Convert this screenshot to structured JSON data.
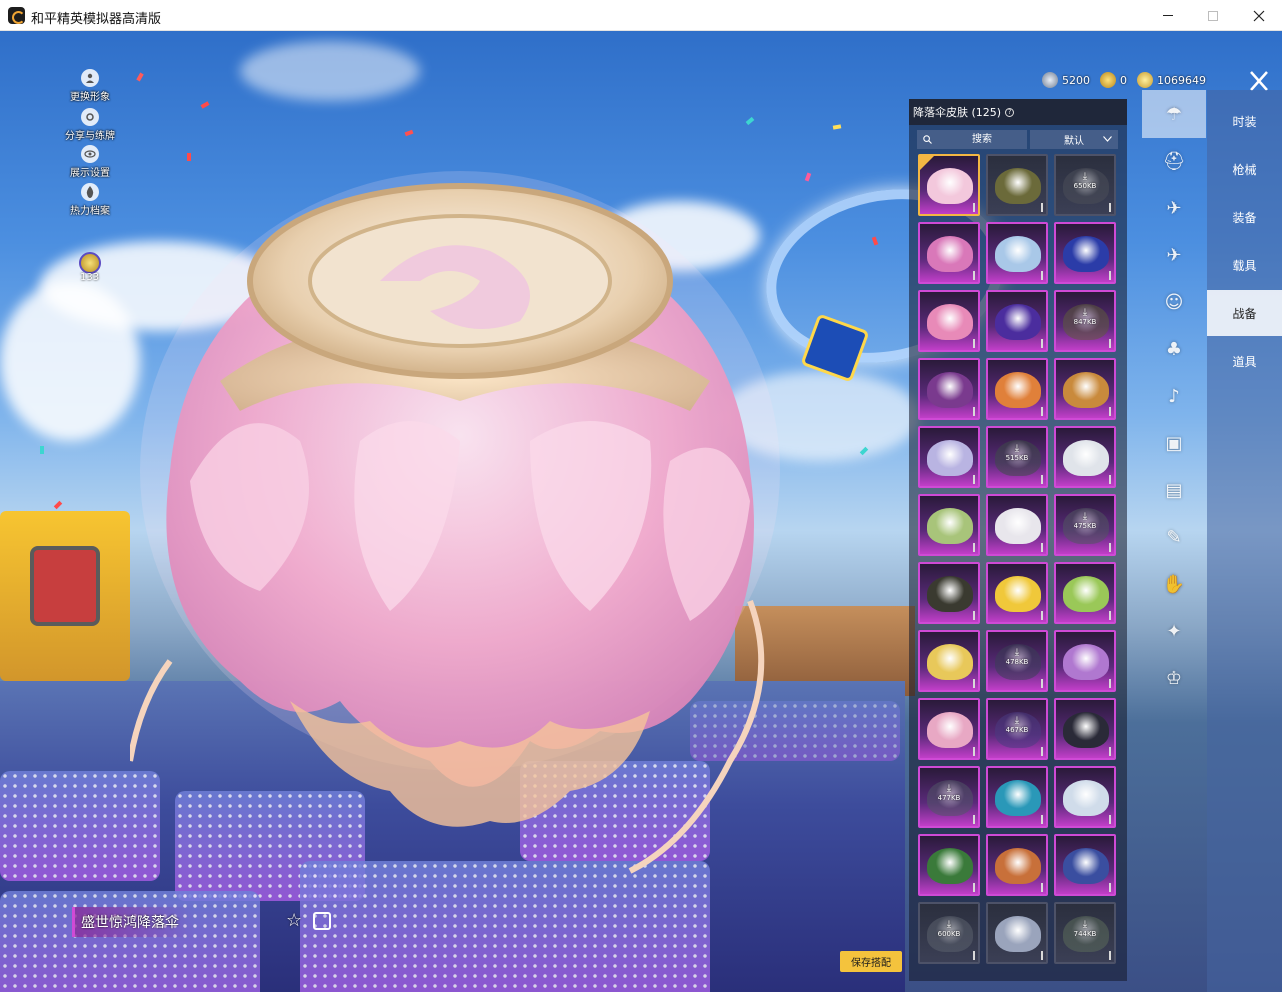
{
  "window": {
    "title": "和平精英模拟器高清版"
  },
  "left_menu": [
    {
      "label": "更换形象",
      "icon": "avatar-icon"
    },
    {
      "label": "分享与练牌",
      "icon": "share-icon"
    },
    {
      "label": "展示设置",
      "icon": "eye-icon"
    },
    {
      "label": "热力档案",
      "icon": "flame-icon"
    }
  ],
  "level": {
    "value": "133"
  },
  "currency": [
    {
      "icon": "silver-coin-icon",
      "value": "5200"
    },
    {
      "icon": "a-coin-icon",
      "value": "0"
    },
    {
      "icon": "gold-coin-icon",
      "value": "1069649"
    }
  ],
  "panel": {
    "title": "降落伞皮肤 (125)",
    "search_placeholder": "搜索",
    "sort_value": "默认"
  },
  "grid_items": [
    {
      "rarity": "purple",
      "color": "#f3c8dc",
      "selected": true,
      "size": ""
    },
    {
      "rarity": "dark",
      "color": "#6b6a3a",
      "size": ""
    },
    {
      "rarity": "dark",
      "color": "#4a4d58",
      "size": "650KB"
    },
    {
      "rarity": "purple",
      "color": "#d978b9",
      "size": ""
    },
    {
      "rarity": "purple",
      "color": "#a9c8e8",
      "size": ""
    },
    {
      "rarity": "purple",
      "color": "#2b3ca8",
      "size": ""
    },
    {
      "rarity": "purple",
      "color": "#e88ab8",
      "size": ""
    },
    {
      "rarity": "purple",
      "color": "#4b2d9e",
      "size": ""
    },
    {
      "rarity": "purple",
      "color": "#5d5a3a",
      "size": "847KB"
    },
    {
      "rarity": "purple",
      "color": "#7a3a8e",
      "size": ""
    },
    {
      "rarity": "purple",
      "color": "#e0803a",
      "size": ""
    },
    {
      "rarity": "purple",
      "color": "#c98a3c",
      "size": ""
    },
    {
      "rarity": "purple",
      "color": "#b9b4e2",
      "size": ""
    },
    {
      "rarity": "purple",
      "color": "#3d4a48",
      "size": "515KB"
    },
    {
      "rarity": "purple",
      "color": "#e0e4ea",
      "size": ""
    },
    {
      "rarity": "purple",
      "color": "#a8c47a",
      "size": ""
    },
    {
      "rarity": "purple",
      "color": "#e8e6ec",
      "size": ""
    },
    {
      "rarity": "purple",
      "color": "#505560",
      "size": "475KB"
    },
    {
      "rarity": "purple",
      "color": "#3a3a30",
      "size": ""
    },
    {
      "rarity": "purple",
      "color": "#f0c83a",
      "size": ""
    },
    {
      "rarity": "purple",
      "color": "#9ac858",
      "size": ""
    },
    {
      "rarity": "purple",
      "color": "#e8c85a",
      "size": ""
    },
    {
      "rarity": "purple",
      "color": "#3a3e56",
      "size": "478KB"
    },
    {
      "rarity": "purple",
      "color": "#b078d0",
      "size": ""
    },
    {
      "rarity": "purple",
      "color": "#e8a8c4",
      "size": ""
    },
    {
      "rarity": "purple",
      "color": "#4a3a80",
      "size": "467KB"
    },
    {
      "rarity": "purple",
      "color": "#2a2a38",
      "size": ""
    },
    {
      "rarity": "purple",
      "color": "#505566",
      "size": "477KB"
    },
    {
      "rarity": "purple",
      "color": "#2a98b8",
      "size": ""
    },
    {
      "rarity": "purple",
      "color": "#d0dcea",
      "size": ""
    },
    {
      "rarity": "purple",
      "color": "#3a7a3a",
      "size": ""
    },
    {
      "rarity": "purple",
      "color": "#c8703a",
      "size": ""
    },
    {
      "rarity": "purple",
      "color": "#3a4ea0",
      "size": ""
    },
    {
      "rarity": "dark",
      "color": "#5a606c",
      "size": "600KB"
    },
    {
      "rarity": "dark",
      "color": "#9aa4bc",
      "size": ""
    },
    {
      "rarity": "dark",
      "color": "#5a6a5a",
      "size": "744KB"
    }
  ],
  "icon_tabs": [
    {
      "name": "parachute-tab-icon",
      "glyph": "☂",
      "active": true
    },
    {
      "name": "backpack-skin-tab-icon",
      "glyph": "⛑",
      "active": false
    },
    {
      "name": "plane-trail-tab-icon",
      "glyph": "✈",
      "active": false
    },
    {
      "name": "plane-tab-icon",
      "glyph": "✈",
      "active": false
    },
    {
      "name": "emote-tab-icon",
      "glyph": "☺",
      "active": false
    },
    {
      "name": "robot-tab-icon",
      "glyph": "♣",
      "active": false
    },
    {
      "name": "sound-tab-icon",
      "glyph": "♪",
      "active": false
    },
    {
      "name": "device-tab-icon",
      "glyph": "▣",
      "active": false
    },
    {
      "name": "gallery-tab-icon",
      "glyph": "▤",
      "active": false
    },
    {
      "name": "spray-tab-icon",
      "glyph": "✎",
      "active": false
    },
    {
      "name": "gesture-tab-icon",
      "glyph": "✋",
      "active": false
    },
    {
      "name": "magic-tab-icon",
      "glyph": "✦",
      "active": false
    },
    {
      "name": "hat-tab-icon",
      "glyph": "♔",
      "active": false
    }
  ],
  "categories": [
    {
      "label": "时装",
      "active": false
    },
    {
      "label": "枪械",
      "active": false
    },
    {
      "label": "装备",
      "active": false
    },
    {
      "label": "载具",
      "active": false
    },
    {
      "label": "战备",
      "active": true
    },
    {
      "label": "道具",
      "active": false
    }
  ],
  "item": {
    "name": "盛世惊鸿降落伞",
    "save_label": "保存搭配"
  },
  "colors": {
    "accent_gold": "#f4c33d",
    "rarity_purple": "#cf4ad6"
  }
}
